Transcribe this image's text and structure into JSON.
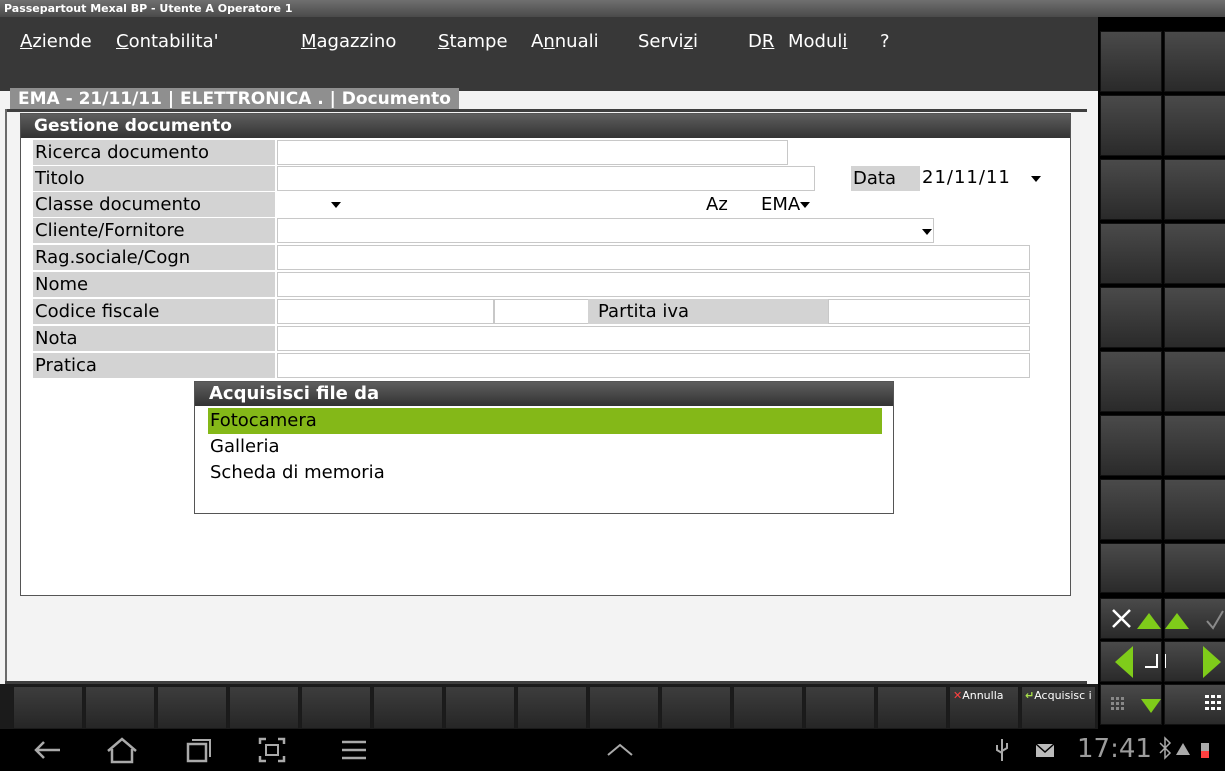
{
  "window": {
    "title": "Passepartout Mexal BP - Utente A Operatore 1"
  },
  "menu": [
    {
      "pre": "",
      "ul": "A",
      "post": "ziende"
    },
    {
      "pre": "",
      "ul": "C",
      "post": "ontabilita'"
    },
    {
      "pre": "",
      "ul": "M",
      "post": "agazzino"
    },
    {
      "pre": "",
      "ul": "S",
      "post": "tampe"
    },
    {
      "pre": "A",
      "ul": "n",
      "post": "nuali"
    },
    {
      "pre": "Servi",
      "ul": "z",
      "post": "i"
    },
    {
      "pre": "D",
      "ul": "R",
      "post": ""
    },
    {
      "pre": "Modul",
      "ul": "i",
      "post": ""
    },
    {
      "pre": "",
      "ul": "",
      "post": "?"
    }
  ],
  "form_tab": "EMA - 21/11/11 | ELETTRONICA . | Documento",
  "panel": {
    "title": "Gestione documento",
    "labels": {
      "ricerca": "Ricerca documento",
      "titolo": "Titolo",
      "classe": "Classe documento",
      "cliente": "Cliente/Fornitore",
      "ragsoc": "Rag.sociale/Cogn",
      "nome": "Nome",
      "codfisc": "Codice fiscale",
      "piva": "Partita iva",
      "nota": "Nota",
      "pratica": "Pratica",
      "data": "Data",
      "az": "Az"
    },
    "values": {
      "data": "21/11/11",
      "az": "EMA"
    }
  },
  "popup": {
    "title": "Acquisisci file da",
    "options": [
      "Fotocamera",
      "Galleria",
      "Scheda di memoria"
    ],
    "selected_index": 0,
    "selected_color": "#84b818"
  },
  "function_bar": {
    "annulla": "Annulla",
    "acquisisci": "Acquisisc i"
  },
  "navbar": {
    "clock": "17:41"
  }
}
